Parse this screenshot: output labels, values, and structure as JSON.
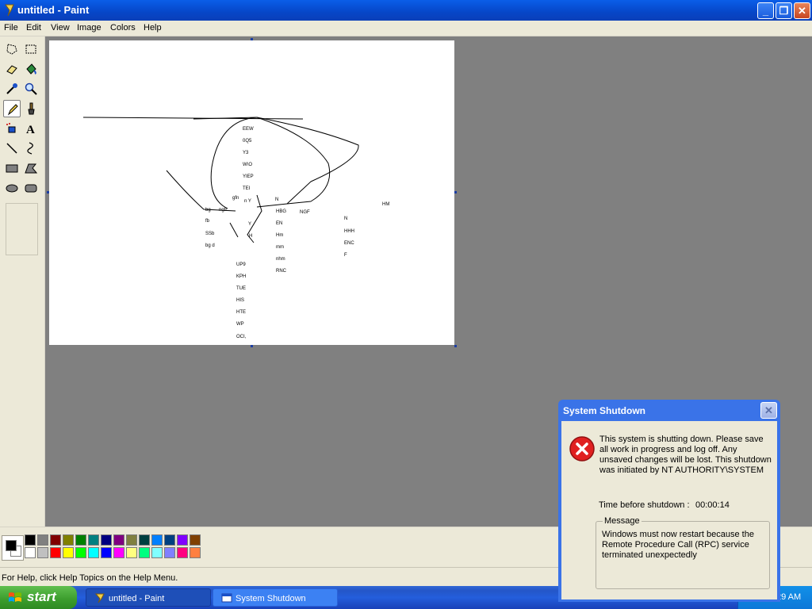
{
  "window": {
    "title": "untitled - Paint",
    "min_label": "_",
    "max_label": "❐",
    "close_label": "✕"
  },
  "menu": [
    "File",
    "Edit",
    "View",
    "Image",
    "Colors",
    "Help"
  ],
  "tools": [
    "free-form-select",
    "select",
    "eraser",
    "fill-with-color",
    "pick-color",
    "magnifier",
    "pencil",
    "brush",
    "airbrush",
    "text",
    "line",
    "curve",
    "rectangle",
    "polygon",
    "ellipse",
    "rounded-rectangle"
  ],
  "canvas_text": [
    "EEW",
    "0Q5",
    "Y3",
    "W\\O",
    "YIEP",
    "TEI",
    "gfn",
    "n Y",
    "N",
    "bg",
    "ngtr",
    "HBG",
    "NGF",
    "HM",
    "fb",
    "Y",
    "EN",
    "N",
    "SSb",
    "H",
    "Hm",
    "HHH",
    "bg d",
    "mm",
    "ENC",
    "F",
    "nhm",
    "UP9",
    "RNC",
    "KPH",
    "TUE",
    "HIS",
    "HTE",
    "WP",
    "OCI,"
  ],
  "colors": {
    "foreground": "#000000",
    "background": "#ffffff",
    "palette_row1": [
      "#000000",
      "#808080",
      "#800000",
      "#808000",
      "#008000",
      "#008080",
      "#000080",
      "#800080",
      "#808040",
      "#004040",
      "#0080ff",
      "#004080",
      "#8000ff",
      "#804000"
    ],
    "palette_row2": [
      "#ffffff",
      "#c0c0c0",
      "#ff0000",
      "#ffff00",
      "#00ff00",
      "#00ffff",
      "#0000ff",
      "#ff00ff",
      "#ffff80",
      "#00ff80",
      "#80ffff",
      "#8080ff",
      "#ff0080",
      "#ff8040"
    ]
  },
  "status": {
    "text": "For Help, click Help Topics on the Help Menu."
  },
  "taskbar": {
    "start_label": "start",
    "tasks": [
      "untitled - Paint",
      "System Shutdown"
    ],
    "clock": "29 AM"
  },
  "dialog": {
    "title": "System Shutdown",
    "message": "This system is shutting down. Please save all work in progress and log off. Any unsaved changes will be lost. This shutdown was initiated by NT AUTHORITY\\SYSTEM",
    "time_label": "Time before shutdown :",
    "time_value": "00:00:14",
    "group_label": "Message",
    "group_text": "Windows must now restart because the Remote Procedure Call (RPC) service terminated unexpectedly"
  }
}
